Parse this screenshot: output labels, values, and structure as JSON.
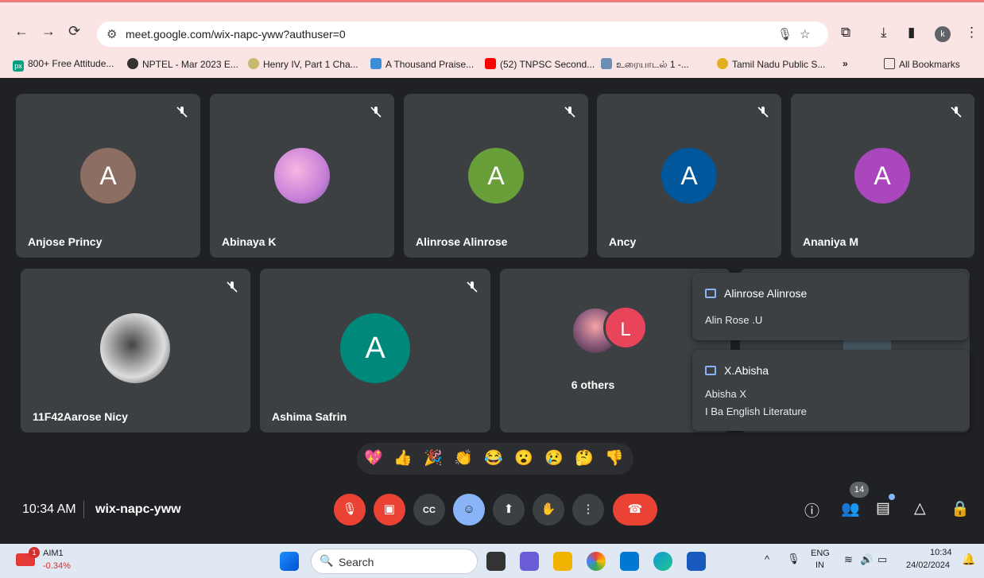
{
  "browser": {
    "url": "meet.google.com/wix-napc-yww?authuser=0",
    "profile_initial": "k",
    "bookmarks": [
      {
        "label": "800+ Free Attitude...",
        "color": "#05a081",
        "icon": "px"
      },
      {
        "label": "NPTEL - Mar 2023 E...",
        "color": "#333333",
        "icon": ""
      },
      {
        "label": "Henry IV, Part 1 Cha...",
        "color": "#8a7a3a",
        "icon": ""
      },
      {
        "label": "A Thousand Praise...",
        "color": "#3b8fd6",
        "icon": ""
      },
      {
        "label": "(52) TNPSC Second...",
        "color": "#ff0000",
        "icon": ""
      },
      {
        "label": "உரையாடல் 1 -...",
        "color": "#6a8fb3",
        "icon": ""
      },
      {
        "label": "Tamil Nadu Public S...",
        "color": "#e0b020",
        "icon": ""
      }
    ],
    "more_label": "»",
    "all_bookmarks": "All Bookmarks"
  },
  "participants_row1": [
    {
      "name": "Anjose Princy",
      "initial": "A",
      "color": "#8d6e63"
    },
    {
      "name": "Abinaya K",
      "initial": "",
      "color": "photo"
    },
    {
      "name": "Alinrose Alinrose",
      "initial": "A",
      "color": "#689f38"
    },
    {
      "name": "Ancy",
      "initial": "A",
      "color": "#01579b"
    },
    {
      "name": "Ananiya M",
      "initial": "A",
      "color": "#ab47bc"
    }
  ],
  "participants_row2": [
    {
      "name": "11F42Aarose Nicy",
      "initial": "",
      "color": "photo2"
    },
    {
      "name": "Ashima Safrin",
      "initial": "A",
      "color": "#00897b"
    }
  ],
  "others": {
    "label": "6 others",
    "initial": "L",
    "color": "#e8455a"
  },
  "chat_popups": [
    {
      "sender": "Alinrose Alinrose",
      "lines": [
        "Alin Rose .U"
      ]
    },
    {
      "sender": "X.Abisha",
      "lines": [
        "Abisha X",
        "I Ba English Literature"
      ]
    }
  ],
  "reactions": [
    "💖",
    "👍",
    "🎉",
    "👏",
    "😂",
    "😮",
    "😢",
    "🤔",
    "👎"
  ],
  "meeting": {
    "time": "10:34 AM",
    "code": "wix-napc-yww",
    "participant_count": "14"
  },
  "taskbar": {
    "stock_name": "AIM1",
    "stock_change": "-0.34%",
    "stock_badge": "1",
    "search_placeholder": "Search",
    "lang_top": "ENG",
    "lang_bottom": "IN",
    "clock_time": "10:34",
    "clock_date": "24/02/2024"
  }
}
